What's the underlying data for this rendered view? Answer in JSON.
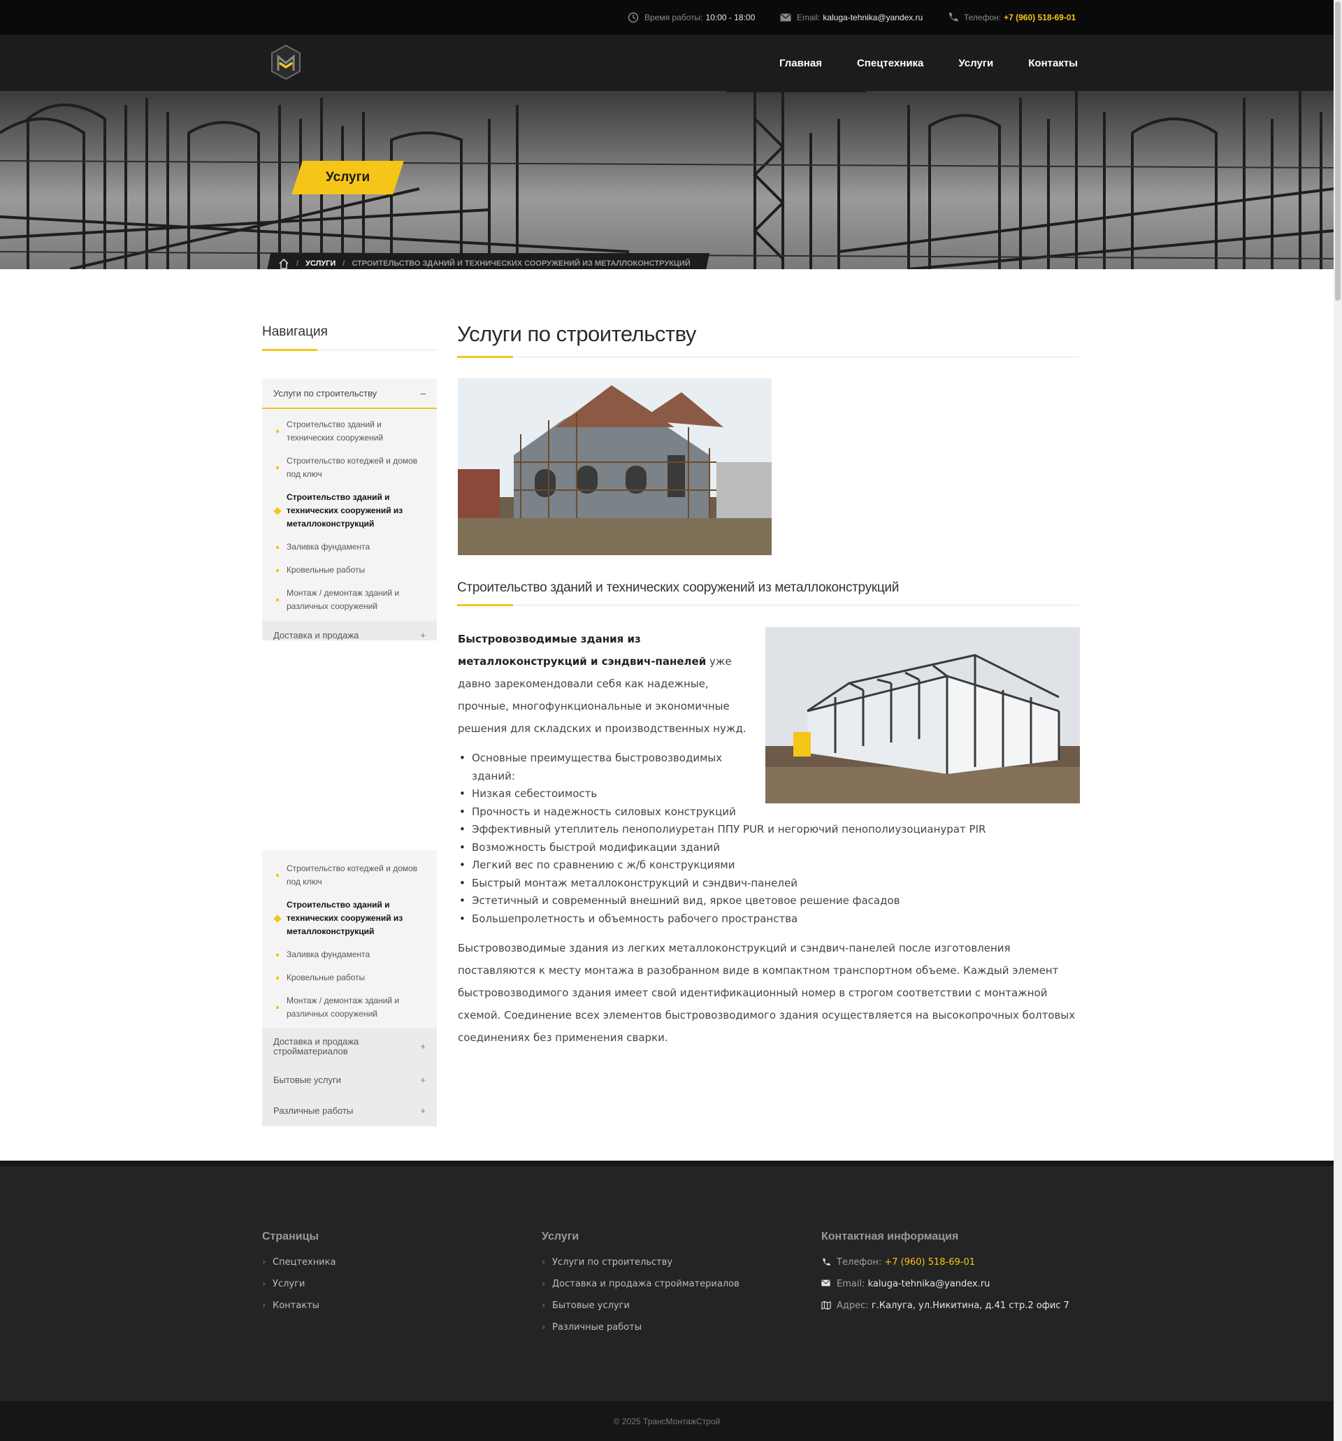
{
  "topbar": {
    "hours_label": "Время работы:",
    "hours_value": "10:00 - 18:00",
    "email_label": "Email:",
    "email_value": "kaluga-tehnika@yandex.ru",
    "phone_label": "Телефон:",
    "phone_value": "+7 (960) 518-69-01"
  },
  "nav": {
    "items": [
      {
        "label": "Главная"
      },
      {
        "label": "Спецтехника"
      },
      {
        "label": "Услуги"
      },
      {
        "label": "Контакты"
      }
    ]
  },
  "hero": {
    "title": "Услуги",
    "breadcrumb": [
      "Услуги",
      "Строительство зданий и технических сооружений из металлоконструкций"
    ]
  },
  "sidebar": {
    "title": "Навигация",
    "expanded_category": "Услуги по строительству",
    "collapse_symbol": "–",
    "expand_symbol": "+",
    "sub_items": [
      {
        "label": "Строительство зданий и технических сооружений"
      },
      {
        "label": "Строительство котеджей и домов под ключ"
      },
      {
        "label": "Строительство зданий и технических сооружений из металлоконструкций"
      },
      {
        "label": "Заливка фундамента"
      },
      {
        "label": "Кровельные работы"
      },
      {
        "label": "Монтаж / демонтаж зданий и различных сооружений"
      }
    ],
    "partial_category": "Доставка и продажа",
    "lower_sub_items": [
      {
        "label": "Строительство котеджей и домов под ключ"
      },
      {
        "label": "Строительство зданий и технических сооружений из металлоконструкций"
      },
      {
        "label": "Заливка фундамента"
      },
      {
        "label": "Кровельные работы"
      },
      {
        "label": "Монтаж / демонтаж зданий и различных сооружений"
      }
    ],
    "other_categories": [
      {
        "label": "Доставка и продажа стройматериалов"
      },
      {
        "label": "Бытовые услуги"
      },
      {
        "label": "Различные работы"
      }
    ]
  },
  "main": {
    "title": "Услуги по строительству",
    "subtitle": "Строительство зданий и технических сооружений из металлоконструкций",
    "intro_bold": "Быстровозводимые здания из металлоконструкций и сэндвич-панелей",
    "intro_rest": " уже давно зарекомендовали себя как надежные, прочные, многофункциональные и экономичные решения для складских и производственных нужд.",
    "bullets": [
      "Основные преимущества быстровозводимых зданий:",
      "Низкая себестоимость",
      "Прочность и надежность силовых конструкций",
      "Эффективный утеплитель пенополиуретан ППУ PUR и негорючий пенополиузоцианурат PIR",
      "Возможность быстрой модификации зданий",
      "Легкий вес по сравнению с ж/б конструкциями",
      "Быстрый монтаж металлоконструкций и сэндвич-панелей",
      "Эстетичный и современный внешний вид, яркое цветовое решение фасадов",
      "Большепролетность и объемность рабочего пространства"
    ],
    "paragraph": "Быстровозводимые здания из легких металлоконструкций и сэндвич-панелей после изготовления поставляются к месту монтажа в разобранном виде в компактном транспортном объеме. Каждый элемент быстровозводимого здания имеет свой идентификационный номер в строгом соответствии с монтажной схемой. Соединение всех элементов быстровозводимого здания осуществляется на высокопрочных болтовых соединениях без применения сварки."
  },
  "footer": {
    "pages_title": "Страницы",
    "pages": [
      "Спецтехника",
      "Услуги",
      "Контакты"
    ],
    "services_title": "Услуги",
    "services": [
      "Услуги по строительству",
      "Доставка и продажа стройматериалов",
      "Бытовые услуги",
      "Различные работы"
    ],
    "contacts_title": "Контактная информация",
    "phone_label": "Телефон:",
    "phone_value": "+7 (960) 518-69-01",
    "email_label": "Email:",
    "email_value": "kaluga-tehnika@yandex.ru",
    "address_label": "Адрес:",
    "address_value": "г.Калуга, ул.Никитина, д.41 стр.2 офис 7",
    "copyright": "© 2025 ТрансМонтажСтрой"
  },
  "colors": {
    "accent": "#f5c518",
    "dark": "#1c1c1c",
    "footer": "#242424"
  }
}
